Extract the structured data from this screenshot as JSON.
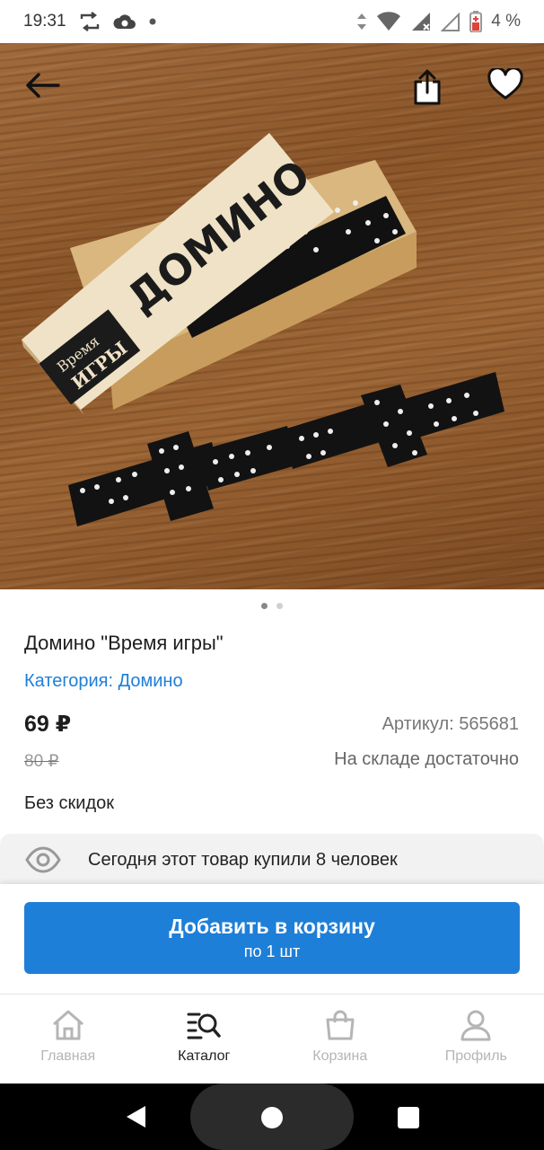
{
  "status_bar": {
    "time": "19:31",
    "battery": "4 %",
    "icons": [
      "sync-icon",
      "cloud-icon",
      "dot-icon",
      "data-arrows-icon",
      "wifi-icon",
      "signal-icon",
      "signal-empty-icon",
      "battery-low-icon"
    ]
  },
  "hero": {
    "image_description_icon": "domino-box-photo",
    "box_lid_text": "ДОМИНО",
    "logo_text_top": "Время",
    "logo_text_bottom": "ИГРЫ",
    "pager": {
      "count": 2,
      "active": 0
    }
  },
  "product": {
    "title": "Домино \"Время игры\"",
    "category": "Категория: Домино",
    "price": "69 ₽",
    "article": "Артикул: 565681",
    "old_price": "80 ₽",
    "stock": "На складе достаточно",
    "discount": "Без скидок"
  },
  "buy_info": {
    "text": "Сегодня этот товар купили 8 человек"
  },
  "add_button": {
    "line1": "Добавить в корзину",
    "line2": "по 1 шт"
  },
  "bottom_nav": {
    "items": [
      {
        "label": "Главная",
        "icon": "home-icon",
        "active": false
      },
      {
        "label": "Каталог",
        "icon": "catalog-search-icon",
        "active": true
      },
      {
        "label": "Корзина",
        "icon": "bag-icon",
        "active": false
      },
      {
        "label": "Профиль",
        "icon": "profile-icon",
        "active": false
      }
    ]
  },
  "colors": {
    "accent": "#1e7fd8",
    "old_price_strike": "#e0433a"
  }
}
